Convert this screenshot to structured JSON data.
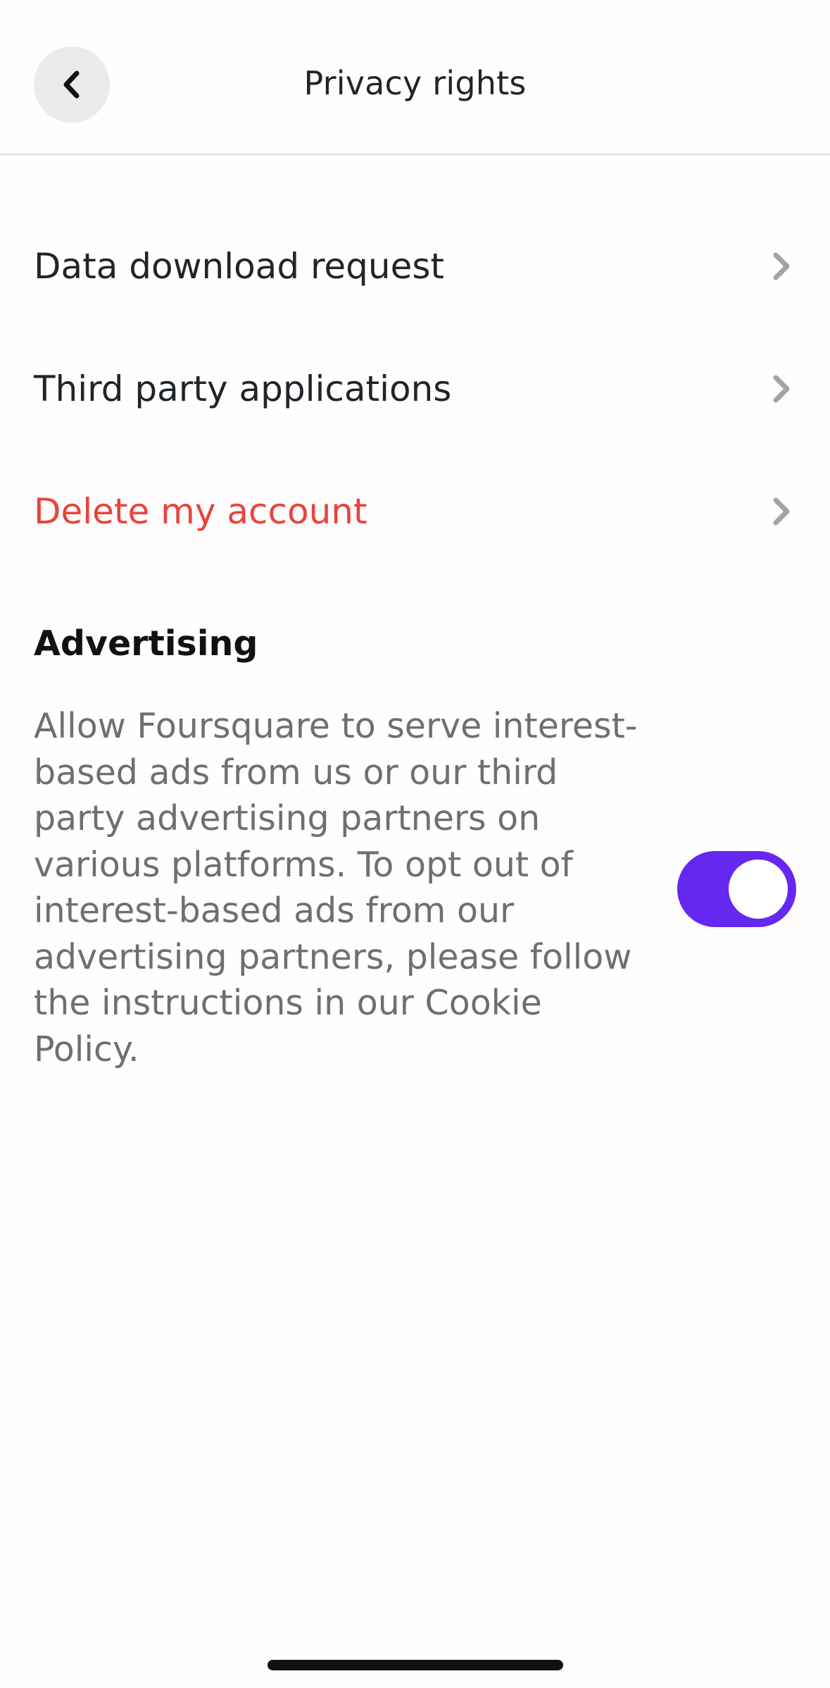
{
  "header": {
    "title": "Privacy rights",
    "back_icon": "chevron-left-icon"
  },
  "menu": {
    "items": [
      {
        "label": "Data download request",
        "icon": "chevron-right-icon"
      },
      {
        "label": "Third party applications",
        "icon": "chevron-right-icon"
      },
      {
        "label": "Delete my account",
        "icon": "chevron-right-icon",
        "color": "#e8443c"
      }
    ]
  },
  "advertising": {
    "title": "Advertising",
    "description": "Allow Foursquare to serve interest-based ads from us or our third party advertising partners on various platforms. To opt out of interest-based ads from our advertising partners, please follow the instructions in our Cookie Policy.",
    "toggle_on": true,
    "toggle_color": "#6428f0"
  }
}
